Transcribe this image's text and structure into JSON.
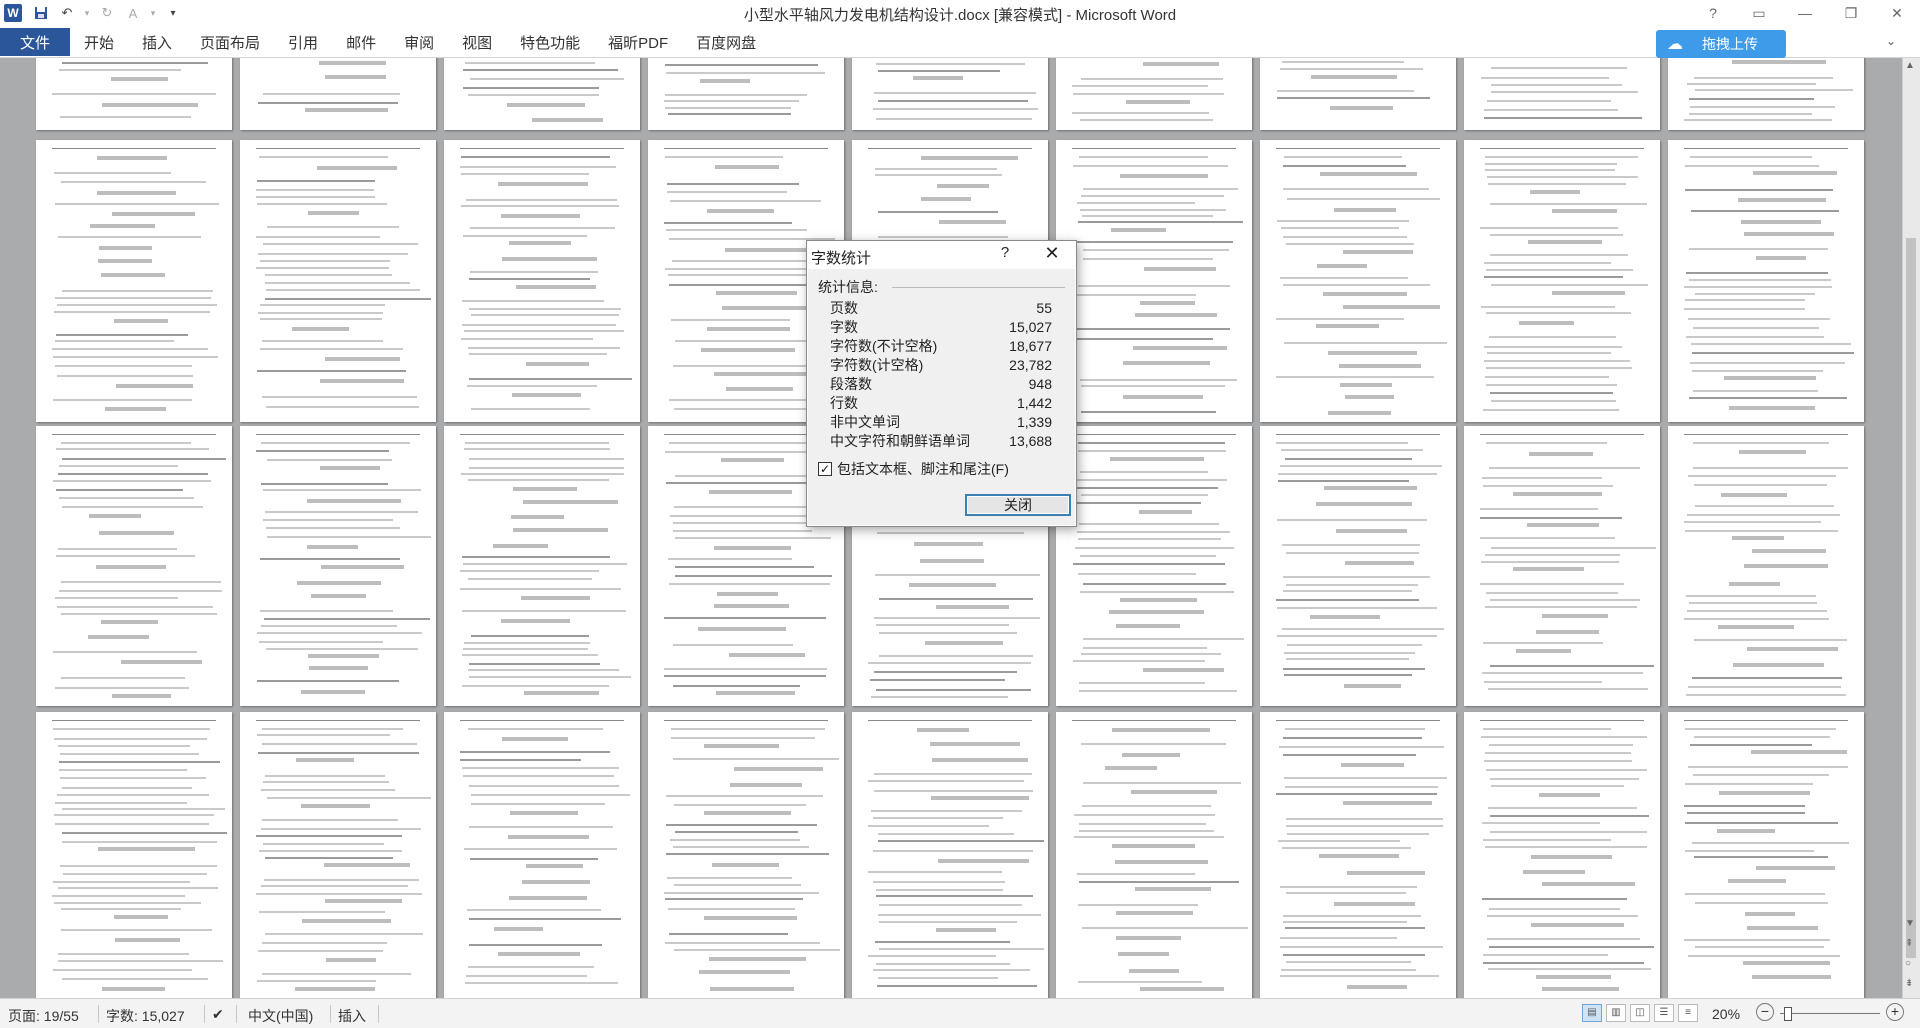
{
  "window": {
    "title": "小型水平轴风力发电机结构设计.docx [兼容模式] - Microsoft Word",
    "app_icon_letter": "W"
  },
  "quick_access": {
    "save_icon": "save-icon",
    "undo_icon": "undo-icon",
    "redo_icon": "redo-icon",
    "format_icon": "format-icon",
    "customize_icon": "customize-icon"
  },
  "ribbon": {
    "file_tab": "文件",
    "tabs": [
      "开始",
      "插入",
      "页面布局",
      "引用",
      "邮件",
      "审阅",
      "视图",
      "特色功能",
      "福昕PDF",
      "百度网盘"
    ],
    "upload_button": "拖拽上传"
  },
  "dialog": {
    "title": "字数统计",
    "help": "?",
    "close": "✕",
    "section_label": "统计信息:",
    "stats": [
      {
        "label": "页数",
        "value": "55"
      },
      {
        "label": "字数",
        "value": "15,027"
      },
      {
        "label": "字符数(不计空格)",
        "value": "18,677"
      },
      {
        "label": "字符数(计空格)",
        "value": "23,782"
      },
      {
        "label": "段落数",
        "value": "948"
      },
      {
        "label": "行数",
        "value": "1,442"
      },
      {
        "label": "非中文单词",
        "value": "1,339"
      },
      {
        "label": "中文字符和朝鲜语单词",
        "value": "13,688"
      }
    ],
    "checkbox_label": "包括文本框、脚注和尾注(F)",
    "checkbox_checked": true,
    "close_button": "关闭"
  },
  "statusbar": {
    "page": "页面: 19/55",
    "words": "字数: 15,027",
    "language": "中文(中国)",
    "mode": "插入",
    "zoom": "20%"
  }
}
